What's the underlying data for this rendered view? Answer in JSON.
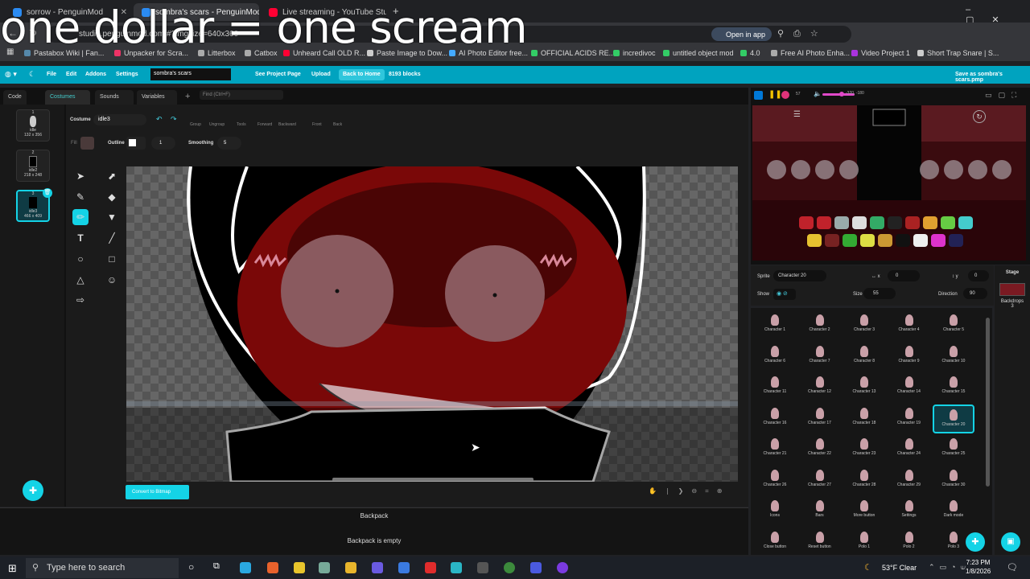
{
  "browser": {
    "tabs": [
      {
        "title": "sorrow - PenguinMod",
        "color": "#2b8bf2"
      },
      {
        "title": "sombra's scars - PenguinMod",
        "color": "#2b8bf2"
      },
      {
        "title": "Live streaming - YouTube Studio",
        "color": "#ff0033"
      }
    ],
    "url": "studio.penguinmod.com/#?imgsize=640x360",
    "open_in_app": "Open in app",
    "bookmarks": [
      "Pastabox Wiki | Fan...",
      "Unpacker for Scra...",
      "Litterbox",
      "Catbox",
      "Unheard Call OLD R...",
      "Paste Image to Dow...",
      "AI Photo Editor free...",
      "OFFICIAL ACIDS RE...",
      "incredivoc",
      "untitled object mod",
      "4.0",
      "Free AI Photo Enha...",
      "Video Project 1",
      "Short Trap Snare | S..."
    ]
  },
  "overlay_caption": "one dollar = one scream",
  "menubar": {
    "items": [
      "File",
      "Edit",
      "Addons",
      "Settings"
    ],
    "project_title": "sombra's scars",
    "see_project": "See Project Page",
    "upload": "Upload",
    "back_home": "Back to Home",
    "blocks": "8193 blocks",
    "save_as": "Save as sombra's scars.pmp"
  },
  "editor_tabs": [
    "Code",
    "Costumes",
    "Sounds",
    "Variables"
  ],
  "find_placeholder": "Find (Ctrl+F)",
  "costumes": [
    {
      "num": "1",
      "name": "idle",
      "size": "132 x 356"
    },
    {
      "num": "2",
      "name": "idle2",
      "size": "218 x 248"
    },
    {
      "num": "3",
      "name": "idle3",
      "size": "466 x 409"
    }
  ],
  "paint": {
    "costume_label": "Costume",
    "costume_name": "idle3",
    "toolbar": [
      "Group",
      "Ungroup",
      "Tools",
      "Forward",
      "Backward",
      "Front",
      "Back"
    ],
    "fill_label": "Fill",
    "outline_label": "Outline",
    "outline_value": "1",
    "smoothing_label": "Smoothing",
    "smoothing_value": "5",
    "convert_button": "Convert to Bitmap"
  },
  "stage": {
    "counter": "57",
    "coords": "-320, -180"
  },
  "sprite_info": {
    "sprite_label": "Sprite",
    "sprite_name": "Character 20",
    "x_label": "x",
    "x_value": "0",
    "y_label": "y",
    "y_value": "0",
    "show_label": "Show",
    "size_label": "Size",
    "size_value": "55",
    "direction_label": "Direction",
    "direction_value": "90"
  },
  "sprites": [
    "Character 1",
    "Character 2",
    "Character 3",
    "Character 4",
    "Character 5",
    "Character 6",
    "Character 7",
    "Character 8",
    "Character 9",
    "Character 10",
    "Character 11",
    "Character 12",
    "Character 13",
    "Character 14",
    "Character 15",
    "Character 16",
    "Character 17",
    "Character 18",
    "Character 19",
    "Character 20",
    "Character 21",
    "Character 22",
    "Character 23",
    "Character 24",
    "Character 25",
    "Character 26",
    "Character 27",
    "Character 28",
    "Character 29",
    "Character 30",
    "Icons",
    "Bars",
    "More button",
    "Settings",
    "Dark mode",
    "Close button",
    "Reset button",
    "Polo 1",
    "Polo 2",
    "Polo 3"
  ],
  "stage_col": {
    "title": "Stage",
    "backdrops_label": "Backdrops",
    "backdrops_count": "3"
  },
  "backpack": {
    "title": "Backpack",
    "empty": "Backpack is empty"
  },
  "taskbar": {
    "search": "Type here to search",
    "weather": "53°F  Clear",
    "time": "7:23 PM",
    "date": "1/8/2026"
  }
}
